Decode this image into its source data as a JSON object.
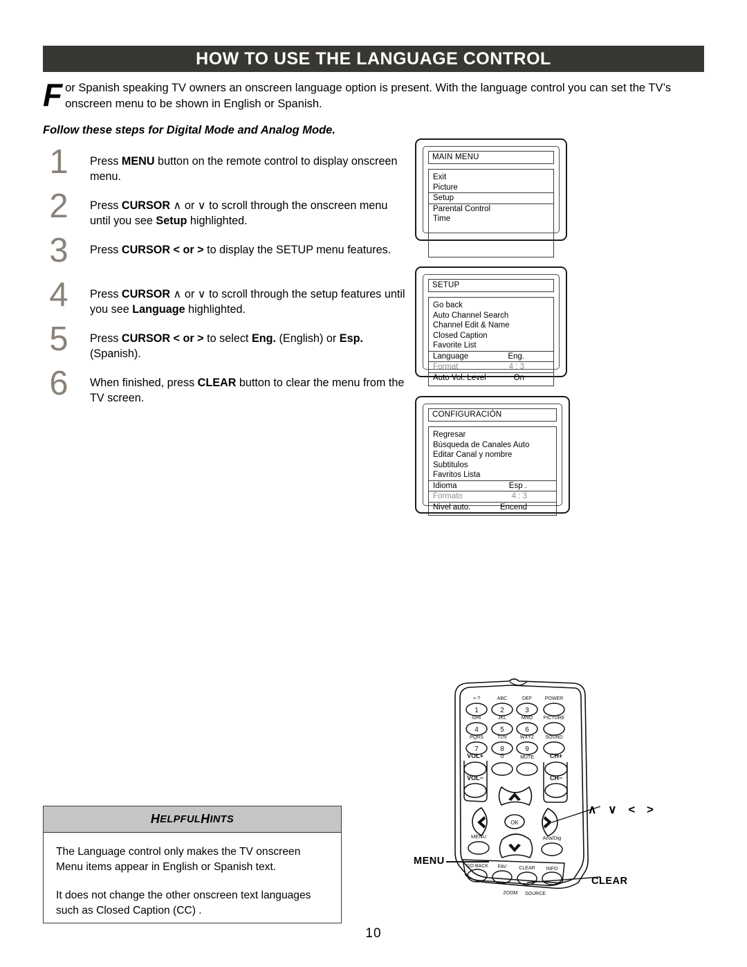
{
  "header": {
    "title": "HOW TO USE THE LANGUAGE CONTROL"
  },
  "intro": {
    "dropcap": "F",
    "text": "or Spanish speaking TV owners an onscreen language option is present. With the language control you can set the TV’s onscreen menu to be shown in English or Spanish.",
    "subheading": "Follow these steps for Digital Mode and Analog Mode."
  },
  "steps": [
    {
      "num": "1",
      "parts": [
        {
          "t": "Press ",
          "b": false
        },
        {
          "t": "MENU",
          "b": true
        },
        {
          "t": " button on the remote control to display onscreen menu.",
          "b": false
        }
      ]
    },
    {
      "num": "2",
      "parts": [
        {
          "t": "Press ",
          "b": false
        },
        {
          "t": "CURSOR",
          "b": true
        },
        {
          "t": " ∧ or ∨ to scroll through the onscreen menu until you see ",
          "b": false
        },
        {
          "t": "Setup",
          "b": true
        },
        {
          "t": " highlighted.",
          "b": false
        }
      ]
    },
    {
      "num": "3",
      "parts": [
        {
          "t": "Press ",
          "b": false
        },
        {
          "t": "CURSOR",
          "b": true
        },
        {
          "t": " < or > ",
          "b": true
        },
        {
          "t": "to display the SETUP menu features.",
          "b": false
        }
      ]
    },
    {
      "num": "4",
      "parts": [
        {
          "t": "Press ",
          "b": false
        },
        {
          "t": "CURSOR",
          "b": true
        },
        {
          "t": " ∧ or ∨ to scroll through the setup features until you see ",
          "b": false
        },
        {
          "t": "Language",
          "b": true
        },
        {
          "t": " highlighted.",
          "b": false
        }
      ]
    },
    {
      "num": "5",
      "parts": [
        {
          "t": "Press ",
          "b": false
        },
        {
          "t": "CURSOR",
          "b": true
        },
        {
          "t": " < or > ",
          "b": true
        },
        {
          "t": "to select ",
          "b": false
        },
        {
          "t": "Eng.",
          "b": true
        },
        {
          "t": " (English) or ",
          "b": false
        },
        {
          "t": "Esp.",
          "b": true
        },
        {
          "t": "(Spanish).",
          "b": false
        }
      ]
    },
    {
      "num": "6",
      "parts": [
        {
          "t": "When finished, press ",
          "b": false
        },
        {
          "t": "CLEAR",
          "b": true
        },
        {
          "t": " button to clear the menu from the TV screen.",
          "b": false
        }
      ]
    }
  ],
  "screens": [
    {
      "id": "main-menu",
      "title": "MAIN MENU",
      "rows": [
        {
          "label": "Exit",
          "value": "",
          "state": "normal"
        },
        {
          "label": "Picture",
          "value": "",
          "state": "normal"
        },
        {
          "label": "Setup",
          "value": "",
          "state": "selected"
        },
        {
          "label": "Parental Control",
          "value": "",
          "state": "normal"
        },
        {
          "label": "Time",
          "value": "",
          "state": "normal"
        }
      ]
    },
    {
      "id": "setup-menu",
      "title": "SETUP",
      "rows": [
        {
          "label": "Go back",
          "value": "",
          "state": "normal"
        },
        {
          "label": "Auto Channel Search",
          "value": "",
          "state": "normal"
        },
        {
          "label": "Channel Edit & Name",
          "value": "",
          "state": "normal"
        },
        {
          "label": "Closed Caption",
          "value": "",
          "state": "normal"
        },
        {
          "label": "Favorite List",
          "value": "",
          "state": "normal"
        },
        {
          "label": "Language",
          "value": "Eng.",
          "state": "selected"
        },
        {
          "label": "Format",
          "value": "4 : 3",
          "state": "dim"
        },
        {
          "label": "Auto Vol. Level",
          "value": "On",
          "state": "normal"
        }
      ]
    },
    {
      "id": "configuracion-menu",
      "title": "CONFIGURACIÓN",
      "rows": [
        {
          "label": "Regresar",
          "value": "",
          "state": "normal"
        },
        {
          "label": "Búsqueda de Canales Auto",
          "value": "",
          "state": "normal"
        },
        {
          "label": "Editar Canal y nombre",
          "value": "",
          "state": "normal"
        },
        {
          "label": "Subtitulos",
          "value": "",
          "state": "normal"
        },
        {
          "label": "Favritos Lista",
          "value": "",
          "state": "normal"
        },
        {
          "label": "Idioma",
          "value": "Esp .",
          "state": "selected"
        },
        {
          "label": "Formato",
          "value": "4 : 3",
          "state": "dim"
        },
        {
          "label": "Nivel auto.",
          "value": "Encend",
          "state": "normal"
        }
      ]
    }
  ],
  "hints": {
    "head_first": "H",
    "head_rest1": "ELPFUL ",
    "head_second": "H",
    "head_rest2": "INTS",
    "paragraph1": "The Language control only makes the TV onscreen Menu items appear in English or Spanish text.",
    "paragraph2": "It does not change the other onscreen text languages such as Closed Caption (CC) ."
  },
  "remote": {
    "keys": [
      {
        "top": "+-?",
        "label": "1"
      },
      {
        "top": "ABC",
        "label": "2"
      },
      {
        "top": "DEF",
        "label": "3"
      },
      {
        "top": "POWER",
        "label": ""
      },
      {
        "top": "GHI",
        "label": "4"
      },
      {
        "top": "JKL",
        "label": "5"
      },
      {
        "top": "MNO",
        "label": "6"
      },
      {
        "top": "PICTURE",
        "label": ""
      },
      {
        "top": "PQRS",
        "label": "7"
      },
      {
        "top": "TUV",
        "label": "8"
      },
      {
        "top": "WXYZ",
        "label": "9"
      },
      {
        "top": "SOUND",
        "label": ""
      },
      {
        "top": "VOL+",
        "label": ""
      },
      {
        "top": "0",
        "label": ""
      },
      {
        "top": "MUTE",
        "label": ""
      },
      {
        "top": "CH+",
        "label": ""
      },
      {
        "top": "VOL−",
        "label": ""
      },
      {
        "top": "CH−",
        "label": ""
      }
    ],
    "ok_label": "OK",
    "menu_label": "MENU",
    "anadig_label": "Ana/Dig",
    "bottom_keys": [
      "GO BACK",
      "FAV",
      "CLEAR",
      "INFO"
    ],
    "bottom_labels": [
      "ZOOM",
      "SOURCE"
    ]
  },
  "callouts": {
    "cursor": "∧ ∨ < >",
    "menu": "MENU",
    "clear": "CLEAR"
  },
  "page_number": "10"
}
